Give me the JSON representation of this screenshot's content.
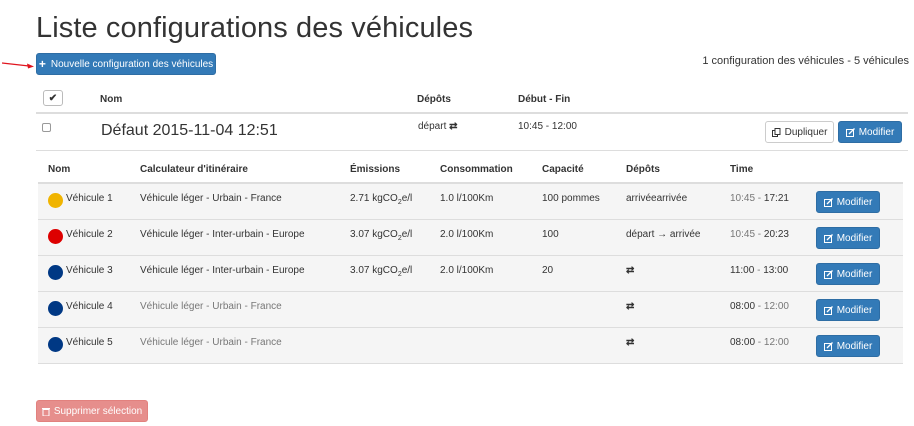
{
  "page": {
    "title": "Liste configurations des véhicules",
    "count_text": "1 configuration des véhicules - 5 véhicules"
  },
  "toolbar": {
    "new_label": "Nouvelle configuration des véhicules",
    "delete_label": "Supprimer sélection"
  },
  "table": {
    "headers": {
      "name": "Nom",
      "depots": "Dépôts",
      "range": "Début - Fin"
    },
    "config": {
      "name": "Défaut 2015-11-04 12:51",
      "depot_text": "départ",
      "depot_icon": "exchange-icon",
      "time": "10:45 - 12:00",
      "duplicate_label": "Dupliquer",
      "modify_label": "Modifier"
    }
  },
  "vehicles": {
    "headers": {
      "name": "Nom",
      "router": "Calculateur d'itinéraire",
      "emissions": "Émissions",
      "consumption": "Consommation",
      "capacity": "Capacité",
      "depots": "Dépôts",
      "time": "Time"
    },
    "rows": [
      {
        "color": "#f0b400",
        "name": "Véhicule 1",
        "router": "Véhicule léger - Urbain - France",
        "router_muted": false,
        "emis_num": "2.71 kgCO",
        "emis_sub": "2",
        "emis_unit": "e/l",
        "consumption": "1.0 l/100Km",
        "capacity": "100 pommes",
        "depots": "arrivéearrivée",
        "start": "10:45",
        "start_muted": true,
        "dash": " - ",
        "end": "17:21",
        "end_muted": false,
        "modify_label": "Modifier"
      },
      {
        "color": "#dd0000",
        "name": "Véhicule 2",
        "router": "Véhicule léger - Inter-urbain - Europe",
        "router_muted": false,
        "emis_num": "3.07 kgCO",
        "emis_sub": "2",
        "emis_unit": "e/l",
        "consumption": "2.0 l/100Km",
        "capacity": "100",
        "depots": "départ → arrivée",
        "start": "10:45",
        "start_muted": true,
        "dash": " - ",
        "end": "20:23",
        "end_muted": false,
        "modify_label": "Modifier"
      },
      {
        "color": "#003884",
        "name": "Véhicule 3",
        "router": "Véhicule léger - Inter-urbain - Europe",
        "router_muted": false,
        "emis_num": "3.07 kgCO",
        "emis_sub": "2",
        "emis_unit": "e/l",
        "consumption": "2.0 l/100Km",
        "capacity": "20",
        "depots": "⇄",
        "start": "11:00",
        "start_muted": false,
        "dash": " - ",
        "end": "13:00",
        "end_muted": false,
        "modify_label": "Modifier"
      },
      {
        "color": "#003884",
        "name": "Véhicule 4",
        "router": "Véhicule léger - Urbain - France",
        "router_muted": true,
        "emis_num": "",
        "emis_sub": "",
        "emis_unit": "",
        "consumption": "",
        "capacity": "",
        "depots": "⇄",
        "start": "08:00",
        "start_muted": false,
        "dash": " - ",
        "end": "12:00",
        "end_muted": true,
        "modify_label": "Modifier"
      },
      {
        "color": "#003884",
        "name": "Véhicule 5",
        "router": "Véhicule léger - Urbain - France",
        "router_muted": true,
        "emis_num": "",
        "emis_sub": "",
        "emis_unit": "",
        "consumption": "",
        "capacity": "",
        "depots": "⇄",
        "start": "08:00",
        "start_muted": false,
        "dash": " - ",
        "end": "12:00",
        "end_muted": true,
        "modify_label": "Modifier"
      }
    ]
  }
}
